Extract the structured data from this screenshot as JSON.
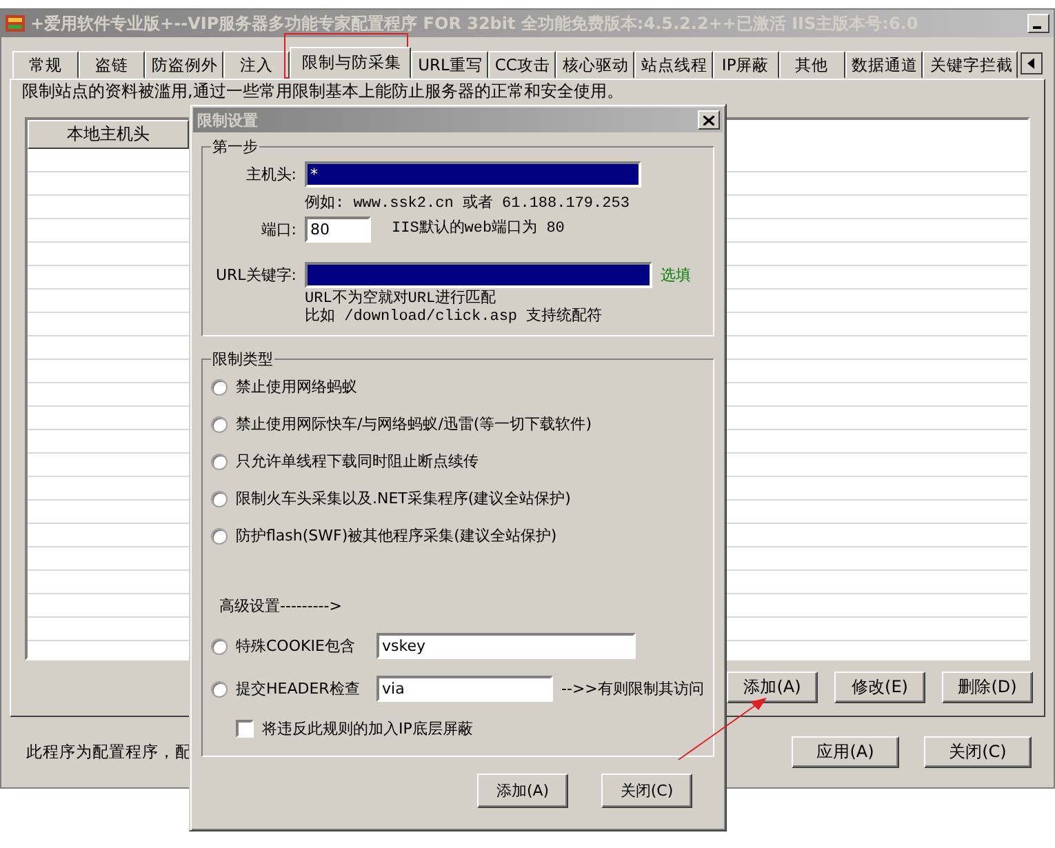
{
  "main_window": {
    "title": "+爱用软件专业版+--VIP服务器多功能专家配置程序 FOR 32bit 全功能免费版本:4.5.2.2++已激活 IIS主版本号:6.0",
    "tabs": [
      {
        "label": "常规",
        "selected": false
      },
      {
        "label": "盗链",
        "selected": false
      },
      {
        "label": "防盗例外",
        "selected": false
      },
      {
        "label": "注入",
        "selected": false
      },
      {
        "label": "限制与防采集",
        "selected": true
      },
      {
        "label": "URL重写",
        "selected": false
      },
      {
        "label": "CC攻击",
        "selected": false
      },
      {
        "label": "核心驱动",
        "selected": false
      },
      {
        "label": "站点线程",
        "selected": false
      },
      {
        "label": "IP屏蔽",
        "selected": false
      },
      {
        "label": "其他",
        "selected": false
      },
      {
        "label": "数据通道",
        "selected": false
      },
      {
        "label": "关键字拦截",
        "selected": false
      }
    ],
    "description": "限制站点的资料被滥用,通过一些常用限制基本上能防止服务器的正常和安全使用。",
    "list": {
      "columns": [
        "本地主机头"
      ]
    },
    "buttons": [
      "添加(A)",
      "修改(E)",
      "删除(D)"
    ],
    "status_text": "此程序为配置程序，配",
    "footer_buttons": [
      "应用(A)",
      "关闭(C)"
    ]
  },
  "dialog": {
    "title": "限制设置",
    "step_group": {
      "title": "第一步",
      "host": {
        "label": "主机头:",
        "value": "*",
        "highlighted": true
      },
      "host_hint": "例如: www.ssk2.cn 或者 61.188.179.253",
      "port": {
        "label": "端口:",
        "value": "80"
      },
      "port_hint": "IIS默认的web端口为 80",
      "url_keyword": {
        "label": "URL关键字:",
        "highlighted": true
      },
      "optional_tag": "选填",
      "url_hints": [
        "URL不为空就对URL进行匹配",
        "比如 /download/click.asp  支持统配符"
      ]
    },
    "type_group": {
      "title": "限制类型",
      "options": [
        {
          "label": "禁止使用网络蚂蚁",
          "selected": false
        },
        {
          "label": "禁止使用网际快车/与网络蚂蚁/迅雷(等一切下载软件)",
          "selected": false
        },
        {
          "label": "只允许单线程下载同时阻止断点续传",
          "selected": false
        },
        {
          "label": "限制火车头采集以及.NET采集程序(建议全站保护)",
          "selected": false
        },
        {
          "label": "防护flash(SWF)被其他程序采集(建议全站保护)",
          "selected": false
        }
      ],
      "advanced_label": "高级设置--------->",
      "advanced_options": [
        {
          "label": "特殊COOKIE包含",
          "selected": false,
          "value": "vskey"
        },
        {
          "label": "提交HEADER检查",
          "selected": false,
          "value": "via",
          "suffix": "-->>有则限制其访问"
        }
      ],
      "ip_block": {
        "label": "将违反此规则的加入IP底层屏蔽",
        "checked": false
      }
    },
    "buttons": [
      "添加(A)",
      "关闭(C)"
    ]
  }
}
